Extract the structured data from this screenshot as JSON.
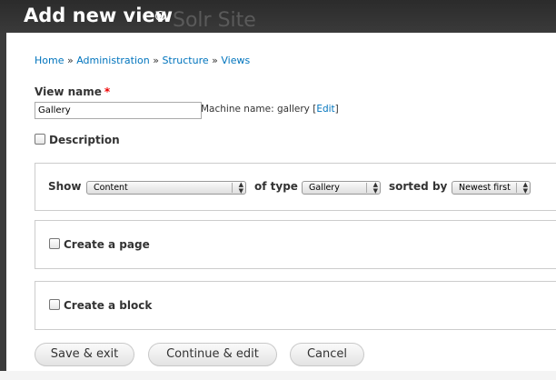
{
  "header": {
    "title": "Add new view",
    "site_name": "Solr Site",
    "shortcut_icon": "plus-circle-icon"
  },
  "breadcrumb": {
    "items": [
      "Home",
      "Administration",
      "Structure",
      "Views"
    ],
    "separator": "»"
  },
  "form": {
    "view_name_label": "View name",
    "required_marker": "*",
    "view_name_value": "Gallery",
    "machine_name_prefix": "Machine name: gallery [",
    "machine_name_edit": "Edit",
    "machine_name_suffix": "]",
    "description_label": "Description",
    "show_label": "Show",
    "show_select": "Content",
    "of_type_label": "of type",
    "type_select": "Gallery",
    "sorted_by_label": "sorted by",
    "sort_select": "Newest first",
    "create_page_label": "Create a page",
    "create_block_label": "Create a block"
  },
  "buttons": {
    "save_exit": "Save & exit",
    "continue_edit": "Continue & edit",
    "cancel": "Cancel"
  },
  "colors": {
    "link": "#0074bd",
    "required": "#ee0000",
    "toolbar": "#2b2b2b"
  }
}
